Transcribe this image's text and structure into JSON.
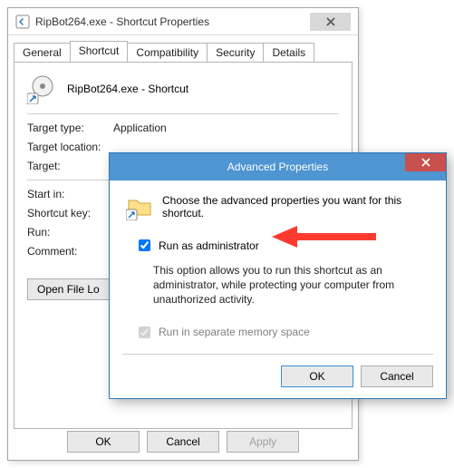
{
  "props_window": {
    "title": "RipBot264.exe - Shortcut Properties",
    "tabs": [
      "General",
      "Shortcut",
      "Compatibility",
      "Security",
      "Details"
    ],
    "active_tab_index": 1,
    "shortcut_name": "RipBot264.exe - Shortcut",
    "fields": {
      "target_type_label": "Target type:",
      "target_type_value": "Application",
      "target_location_label": "Target location:",
      "target_location_value": "",
      "target_label": "Target:",
      "target_value": "",
      "start_in_label": "Start in:",
      "start_in_value": "",
      "shortcut_key_label": "Shortcut key:",
      "shortcut_key_value": "",
      "run_label": "Run:",
      "run_value": "",
      "comment_label": "Comment:",
      "comment_value": ""
    },
    "open_file_location_label": "Open File Lo",
    "buttons": {
      "ok": "OK",
      "cancel": "Cancel",
      "apply": "Apply"
    }
  },
  "adv_window": {
    "title": "Advanced Properties",
    "choose_text": "Choose the advanced properties you want for this shortcut.",
    "run_as_admin_label": "Run as administrator",
    "run_as_admin_checked": true,
    "run_as_admin_desc": "This option allows you to run this shortcut as an administrator, while protecting your computer from unauthorized activity.",
    "separate_memory_label": "Run in separate memory space",
    "separate_memory_checked": true,
    "separate_memory_disabled": true,
    "buttons": {
      "ok": "OK",
      "cancel": "Cancel"
    }
  },
  "icons": {
    "shortcut_props": "shortcut-properties-icon",
    "drive_shortcut": "drive-shortcut-icon",
    "folder_shortcut": "folder-shortcut-icon"
  },
  "annotation": {
    "arrow_color": "#ff3b30"
  }
}
